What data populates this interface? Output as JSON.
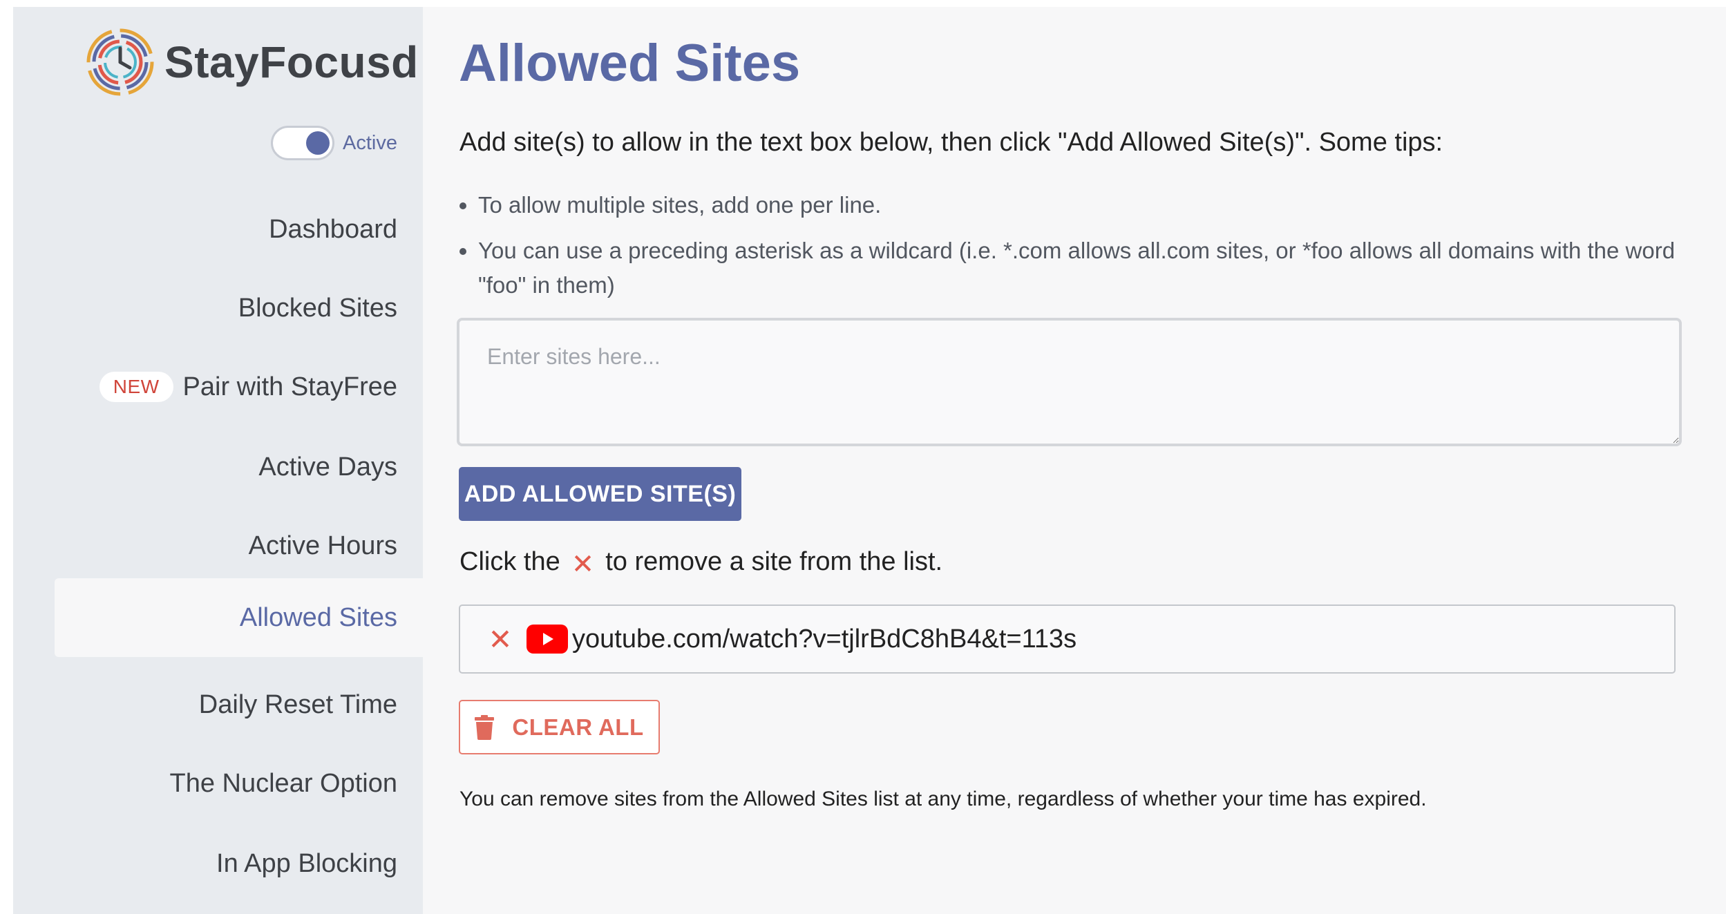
{
  "sidebar": {
    "brand": "StayFocusd",
    "toggle": {
      "label": "Active",
      "on": true
    },
    "badge": "NEW",
    "items": [
      {
        "label": "Dashboard"
      },
      {
        "label": "Blocked Sites"
      },
      {
        "label": "Pair with StayFree"
      },
      {
        "label": "Active Days"
      },
      {
        "label": "Active Hours"
      },
      {
        "label": "Allowed Sites"
      },
      {
        "label": "Daily Reset Time"
      },
      {
        "label": "The Nuclear Option"
      },
      {
        "label": "In App Blocking"
      }
    ],
    "selected": "Allowed Sites"
  },
  "main": {
    "title": "Allowed Sites",
    "intro": "Add site(s) to allow in the text box below, then click \"Add Allowed Site(s)\". Some tips:",
    "tips": [
      "To allow multiple sites, add one per line.",
      "You can use a preceding asterisk as a wildcard (i.e. *.com allows all.com sites, or *foo allows all domains with the word \"foo\" in them)"
    ],
    "input": {
      "placeholder": "Enter sites here...",
      "value": ""
    },
    "add_button": "ADD ALLOWED SITE(S)",
    "remove_hint": {
      "before": "Click the",
      "after": "to remove a site from the list."
    },
    "sites": [
      {
        "url": "youtube.com/watch?v=tjlrBdC8hB4&t=113s",
        "icon": "youtube-icon"
      }
    ],
    "clear_button": "CLEAR ALL",
    "footer": "You can remove sites from the Allowed Sites list at any time, regardless of whether your time has expired."
  },
  "colors": {
    "accent": "#5a69a5",
    "danger": "#e25b4d",
    "sidebar_bg": "#e8ebef",
    "main_bg": "#f7f7f8",
    "youtube_red": "#ff0000"
  }
}
